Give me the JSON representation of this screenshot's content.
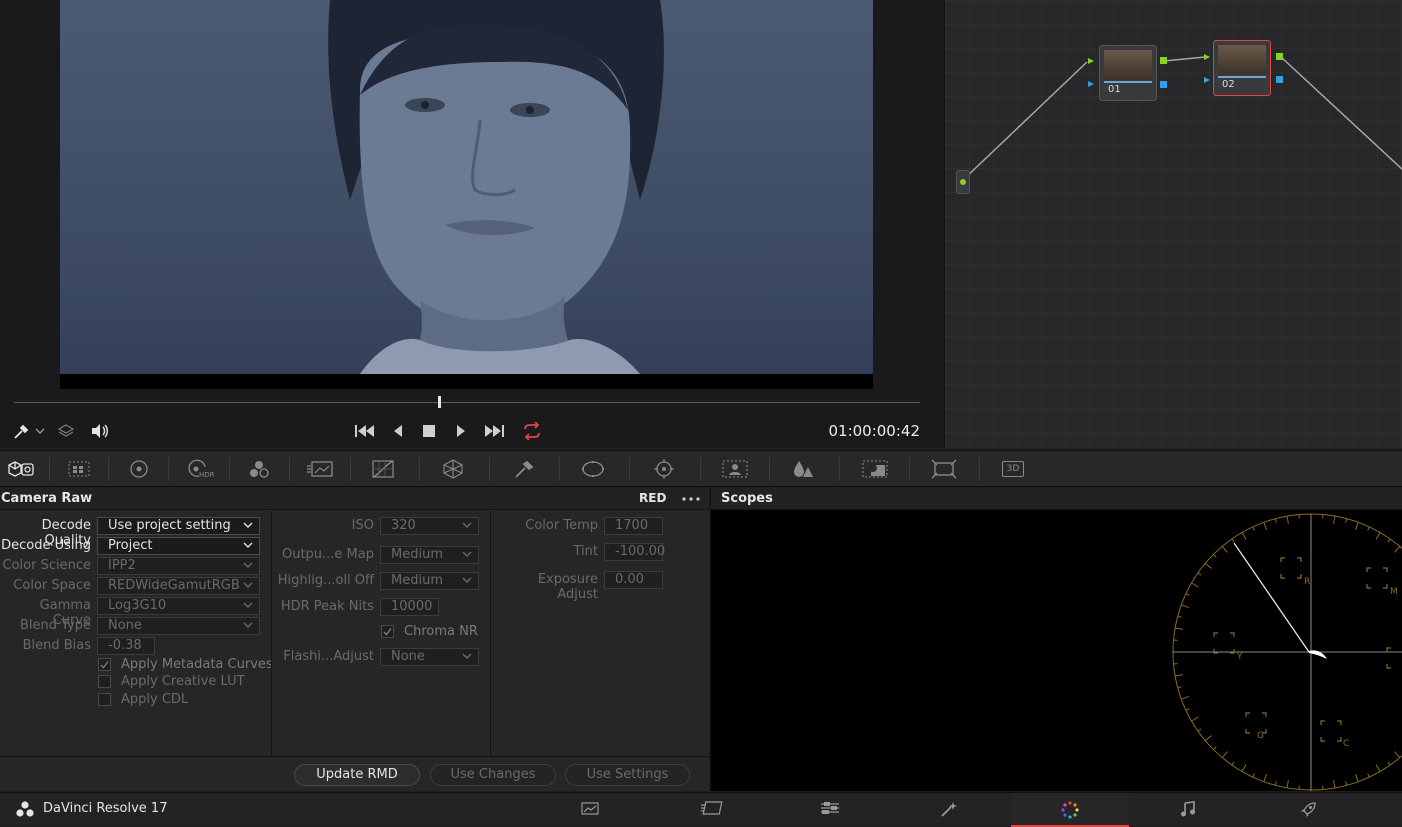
{
  "viewer": {
    "timecode": "01:00:00:42",
    "playhead_fraction": 0.47,
    "tools": [
      "picker-icon",
      "chevron-down-icon",
      "layers-icon",
      "volume-icon"
    ],
    "transport": [
      "go-to-start-icon",
      "step-back-icon",
      "stop-icon",
      "play-icon",
      "go-to-end-icon",
      "loop-icon"
    ]
  },
  "node_graph": {
    "nodes": [
      {
        "label": "01",
        "selected": false
      },
      {
        "label": "02",
        "selected": true
      }
    ]
  },
  "palette_icons": [
    "camera-raw-icon",
    "color-match-icon",
    "color-wheels-icon",
    "hdr-icon",
    "rgb-mixer-icon",
    "motion-effects-icon",
    "curves-icon",
    "color-warper-icon",
    "qualifier-icon",
    "window-icon",
    "tracker-icon",
    "magic-mask-icon",
    "blur-icon",
    "key-icon",
    "sizing-icon",
    "3d-icon"
  ],
  "palette_hdr_label": "HDR",
  "palette_3d_label": "3D",
  "camera_raw": {
    "title": "Camera Raw",
    "raw_type": "RED",
    "left": {
      "decode_quality": {
        "label": "Decode Quality",
        "value": "Use project setting"
      },
      "decode_using": {
        "label": "Decode Using",
        "value": "Project"
      },
      "color_science": {
        "label": "Color Science",
        "value": "IPP2"
      },
      "color_space": {
        "label": "Color Space",
        "value": "REDWideGamutRGB"
      },
      "gamma_curve": {
        "label": "Gamma Curve",
        "value": "Log3G10"
      },
      "blend_type": {
        "label": "Blend Type",
        "value": "None"
      },
      "blend_bias": {
        "label": "Blend Bias",
        "value": "-0.38"
      },
      "apply_metadata_curves": {
        "label": "Apply Metadata Curves",
        "checked": true
      },
      "apply_creative_lut": {
        "label": "Apply Creative LUT",
        "checked": false
      },
      "apply_cdl": {
        "label": "Apply CDL",
        "checked": false
      }
    },
    "middle": {
      "iso": {
        "label": "ISO",
        "value": "320"
      },
      "output_map": {
        "label": "Outpu...e Map",
        "value": "Medium"
      },
      "highlight_rolloff": {
        "label": "Highlig...oll Off",
        "value": "Medium"
      },
      "hdr_peak_nits": {
        "label": "HDR Peak Nits",
        "value": "10000"
      },
      "chroma_nr": {
        "label": "Chroma NR",
        "checked": true
      },
      "flashing_adjust": {
        "label": "Flashi...Adjust",
        "value": "None"
      }
    },
    "right": {
      "color_temp": {
        "label": "Color Temp",
        "value": "1700"
      },
      "tint": {
        "label": "Tint",
        "value": "-100.00"
      },
      "exposure_adjust": {
        "label": "Exposure Adjust",
        "value": "0.00"
      }
    },
    "footer": {
      "update_rmd": "Update RMD",
      "use_changes": "Use Changes",
      "use_settings": "Use Settings"
    }
  },
  "scopes": {
    "title": "Scopes",
    "vectorscope_targets": [
      "R",
      "M",
      "Y",
      "G",
      "C",
      "B"
    ]
  },
  "page_bar": {
    "app_name": "DaVinci Resolve 17",
    "pages": [
      "media-page-icon",
      "cut-page-icon",
      "edit-page-icon",
      "fusion-page-icon",
      "color-page-icon",
      "fairlight-page-icon",
      "deliver-page-icon"
    ],
    "active_page": "color-page-icon"
  },
  "colors": {
    "accent_red": "#e0463d",
    "node_green": "#8ccf2a",
    "node_blue": "#2fa3e6",
    "vectorscope_gold": "#8a6d24"
  }
}
